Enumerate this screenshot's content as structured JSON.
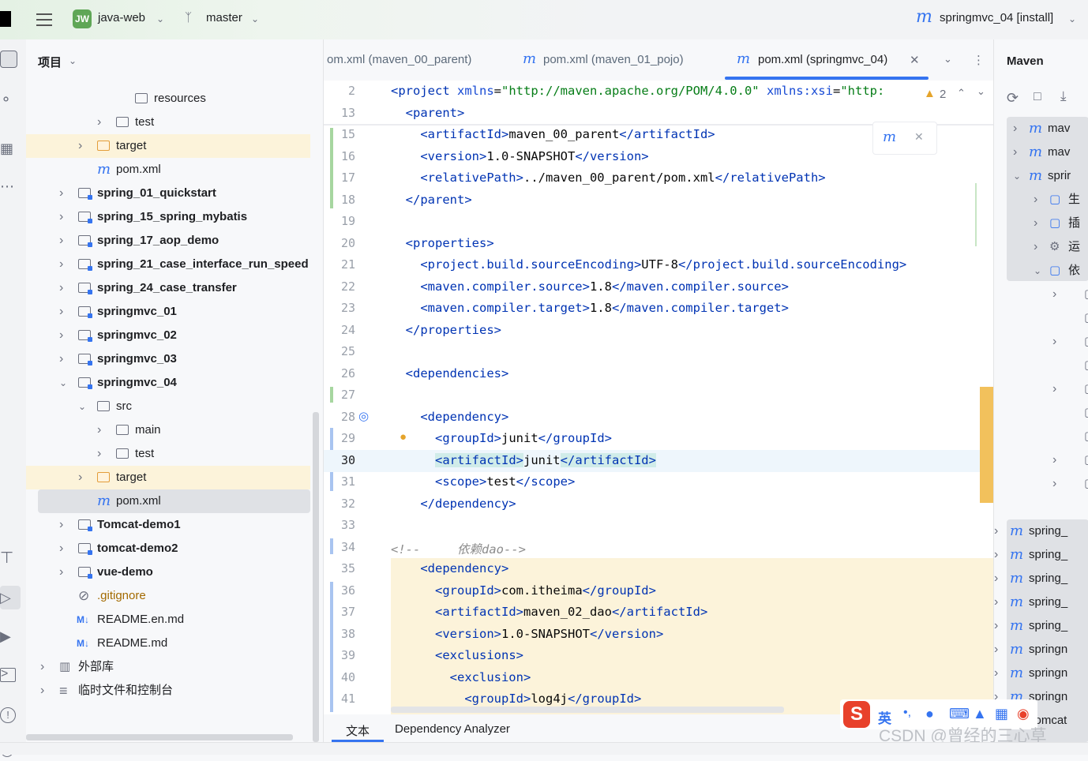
{
  "titlebar": {
    "project_badge": "JW",
    "project_name": "java-web",
    "branch": "master",
    "run_config": "springmvc_04 [install]"
  },
  "project_panel": {
    "title": "项目",
    "rows": [
      {
        "label": "resources",
        "bold": false,
        "icon": "resources-folder-icon"
      },
      {
        "label": "test",
        "bold": false,
        "icon": "folder-icon"
      },
      {
        "label": "target",
        "bold": false,
        "icon": "excluded-folder-icon"
      },
      {
        "label": "pom.xml",
        "bold": false,
        "icon": "maven-file-icon"
      },
      {
        "label": "spring_01_quickstart",
        "bold": true,
        "icon": "module-folder-icon"
      },
      {
        "label": "spring_15_spring_mybatis",
        "bold": true,
        "icon": "module-folder-icon"
      },
      {
        "label": "spring_17_aop_demo",
        "bold": true,
        "icon": "module-folder-icon"
      },
      {
        "label": "spring_21_case_interface_run_speed",
        "bold": true,
        "icon": "module-folder-icon"
      },
      {
        "label": "spring_24_case_transfer",
        "bold": true,
        "icon": "module-folder-icon"
      },
      {
        "label": "springmvc_01",
        "bold": true,
        "icon": "module-folder-icon"
      },
      {
        "label": "springmvc_02",
        "bold": true,
        "icon": "module-folder-icon"
      },
      {
        "label": "springmvc_03",
        "bold": true,
        "icon": "module-folder-icon"
      },
      {
        "label": "springmvc_04",
        "bold": true,
        "icon": "module-folder-icon"
      },
      {
        "label": "src",
        "bold": false,
        "icon": "folder-icon"
      },
      {
        "label": "main",
        "bold": false,
        "icon": "folder-icon"
      },
      {
        "label": "test",
        "bold": false,
        "icon": "folder-icon"
      },
      {
        "label": "target",
        "bold": false,
        "icon": "excluded-folder-icon"
      },
      {
        "label": "pom.xml",
        "bold": false,
        "icon": "maven-file-icon"
      },
      {
        "label": "Tomcat-demo1",
        "bold": true,
        "icon": "module-folder-icon"
      },
      {
        "label": "tomcat-demo2",
        "bold": true,
        "icon": "module-folder-icon"
      },
      {
        "label": "vue-demo",
        "bold": true,
        "icon": "module-folder-icon"
      },
      {
        "label": ".gitignore",
        "bold": false,
        "icon": "ignore-file-icon"
      },
      {
        "label": "README.en.md",
        "bold": false,
        "icon": "markdown-icon"
      },
      {
        "label": "README.md",
        "bold": false,
        "icon": "markdown-icon"
      },
      {
        "label": "外部库",
        "bold": false,
        "icon": "library-icon"
      },
      {
        "label": "临时文件和控制台",
        "bold": false,
        "icon": "scratch-icon"
      }
    ]
  },
  "editor_tabs": [
    {
      "label": "om.xml (maven_00_parent)",
      "active": false
    },
    {
      "label": "pom.xml (maven_01_pojo)",
      "active": false
    },
    {
      "label": "pom.xml (springmvc_04)",
      "active": true
    }
  ],
  "editor": {
    "warning_count": "2",
    "lines": [
      {
        "n": "2",
        "html": "<span class='tg'>&lt;project</span> <span class='at'>xmlns</span>=<span class='st'>\"http://maven.apache.org/POM/4.0.0\"</span> <span class='at'>xmlns:xsi</span>=<span class='st'>\"http:</span>"
      },
      {
        "n": "13",
        "html": "  <span class='tg'>&lt;parent&gt;</span>"
      },
      {
        "n": "15",
        "html": "    <span class='tg'>&lt;artifactId&gt;</span>maven_00_parent<span class='tg'>&lt;/artifactId&gt;</span>"
      },
      {
        "n": "16",
        "html": "    <span class='tg'>&lt;version&gt;</span>1.0-SNAPSHOT<span class='tg'>&lt;/version&gt;</span>"
      },
      {
        "n": "17",
        "html": "    <span class='tg'>&lt;relativePath&gt;</span>../maven_00_parent/pom.xml<span class='tg'>&lt;/relativePath&gt;</span>"
      },
      {
        "n": "18",
        "html": "  <span class='tg'>&lt;/parent&gt;</span>"
      },
      {
        "n": "19",
        "html": ""
      },
      {
        "n": "20",
        "html": "  <span class='tg'>&lt;properties&gt;</span>"
      },
      {
        "n": "21",
        "html": "    <span class='tg'>&lt;project.build.sourceEncoding&gt;</span>UTF-8<span class='tg'>&lt;/project.build.sourceEncoding&gt;</span>"
      },
      {
        "n": "22",
        "html": "    <span class='tg'>&lt;maven.compiler.source&gt;</span>1.8<span class='tg'>&lt;/maven.compiler.source&gt;</span>"
      },
      {
        "n": "23",
        "html": "    <span class='tg'>&lt;maven.compiler.target&gt;</span>1.8<span class='tg'>&lt;/maven.compiler.target&gt;</span>"
      },
      {
        "n": "24",
        "html": "  <span class='tg'>&lt;/properties&gt;</span>"
      },
      {
        "n": "25",
        "html": ""
      },
      {
        "n": "26",
        "html": "  <span class='tg'>&lt;dependencies&gt;</span>"
      },
      {
        "n": "27",
        "html": ""
      },
      {
        "n": "28",
        "html": "    <span class='tg'>&lt;dependency&gt;</span>"
      },
      {
        "n": "29",
        "html": "      <span class='tg'>&lt;groupId&gt;</span>junit<span class='tg'>&lt;/groupId&gt;</span>"
      },
      {
        "n": "30",
        "html": "      <span class='tg' style='background:#d0ece9'>&lt;artifactId&gt;</span>junit<span class='tg' style='background:#d0ece9'>&lt;/artifactId&gt;</span>"
      },
      {
        "n": "31",
        "html": "      <span class='tg'>&lt;scope&gt;</span>test<span class='tg'>&lt;/scope&gt;</span>"
      },
      {
        "n": "32",
        "html": "    <span class='tg'>&lt;/dependency&gt;</span>"
      },
      {
        "n": "33",
        "html": ""
      },
      {
        "n": "34",
        "html": "<span class='cm'>&lt;!--     依赖dao--&gt;</span>"
      },
      {
        "n": "35",
        "html": "    <span class='tg'>&lt;dependency&gt;</span>"
      },
      {
        "n": "36",
        "html": "      <span class='tg'>&lt;groupId&gt;</span>com.itheima<span class='tg'>&lt;/groupId&gt;</span>"
      },
      {
        "n": "37",
        "html": "      <span class='tg'>&lt;artifactId&gt;</span>maven_02_dao<span class='tg'>&lt;/artifactId&gt;</span>"
      },
      {
        "n": "38",
        "html": "      <span class='tg'>&lt;version&gt;</span>1.0-SNAPSHOT<span class='tg'>&lt;/version&gt;</span>"
      },
      {
        "n": "39",
        "html": "      <span class='tg'>&lt;exclusions&gt;</span>"
      },
      {
        "n": "40",
        "html": "        <span class='tg'>&lt;exclusion&gt;</span>"
      },
      {
        "n": "41",
        "html": "          <span class='tg'>&lt;groupId&gt;</span>log4j<span class='tg'>&lt;/groupId&gt;</span>"
      }
    ]
  },
  "bottom_tabs": {
    "text": "文本",
    "analyzer": "Dependency Analyzer"
  },
  "maven_panel": {
    "title": "Maven",
    "rows": [
      "mav",
      "mav",
      "sprir",
      "生",
      "插",
      "运",
      "依",
      "",
      "",
      "",
      "",
      "",
      "",
      "",
      "",
      "",
      "spring_",
      "spring_",
      "spring_",
      "spring_",
      "spring_",
      "springn",
      "springn",
      "springn",
      "Tomcat"
    ]
  },
  "watermark": "CSDN @曾经的三心草",
  "ime": {
    "label": "英"
  }
}
